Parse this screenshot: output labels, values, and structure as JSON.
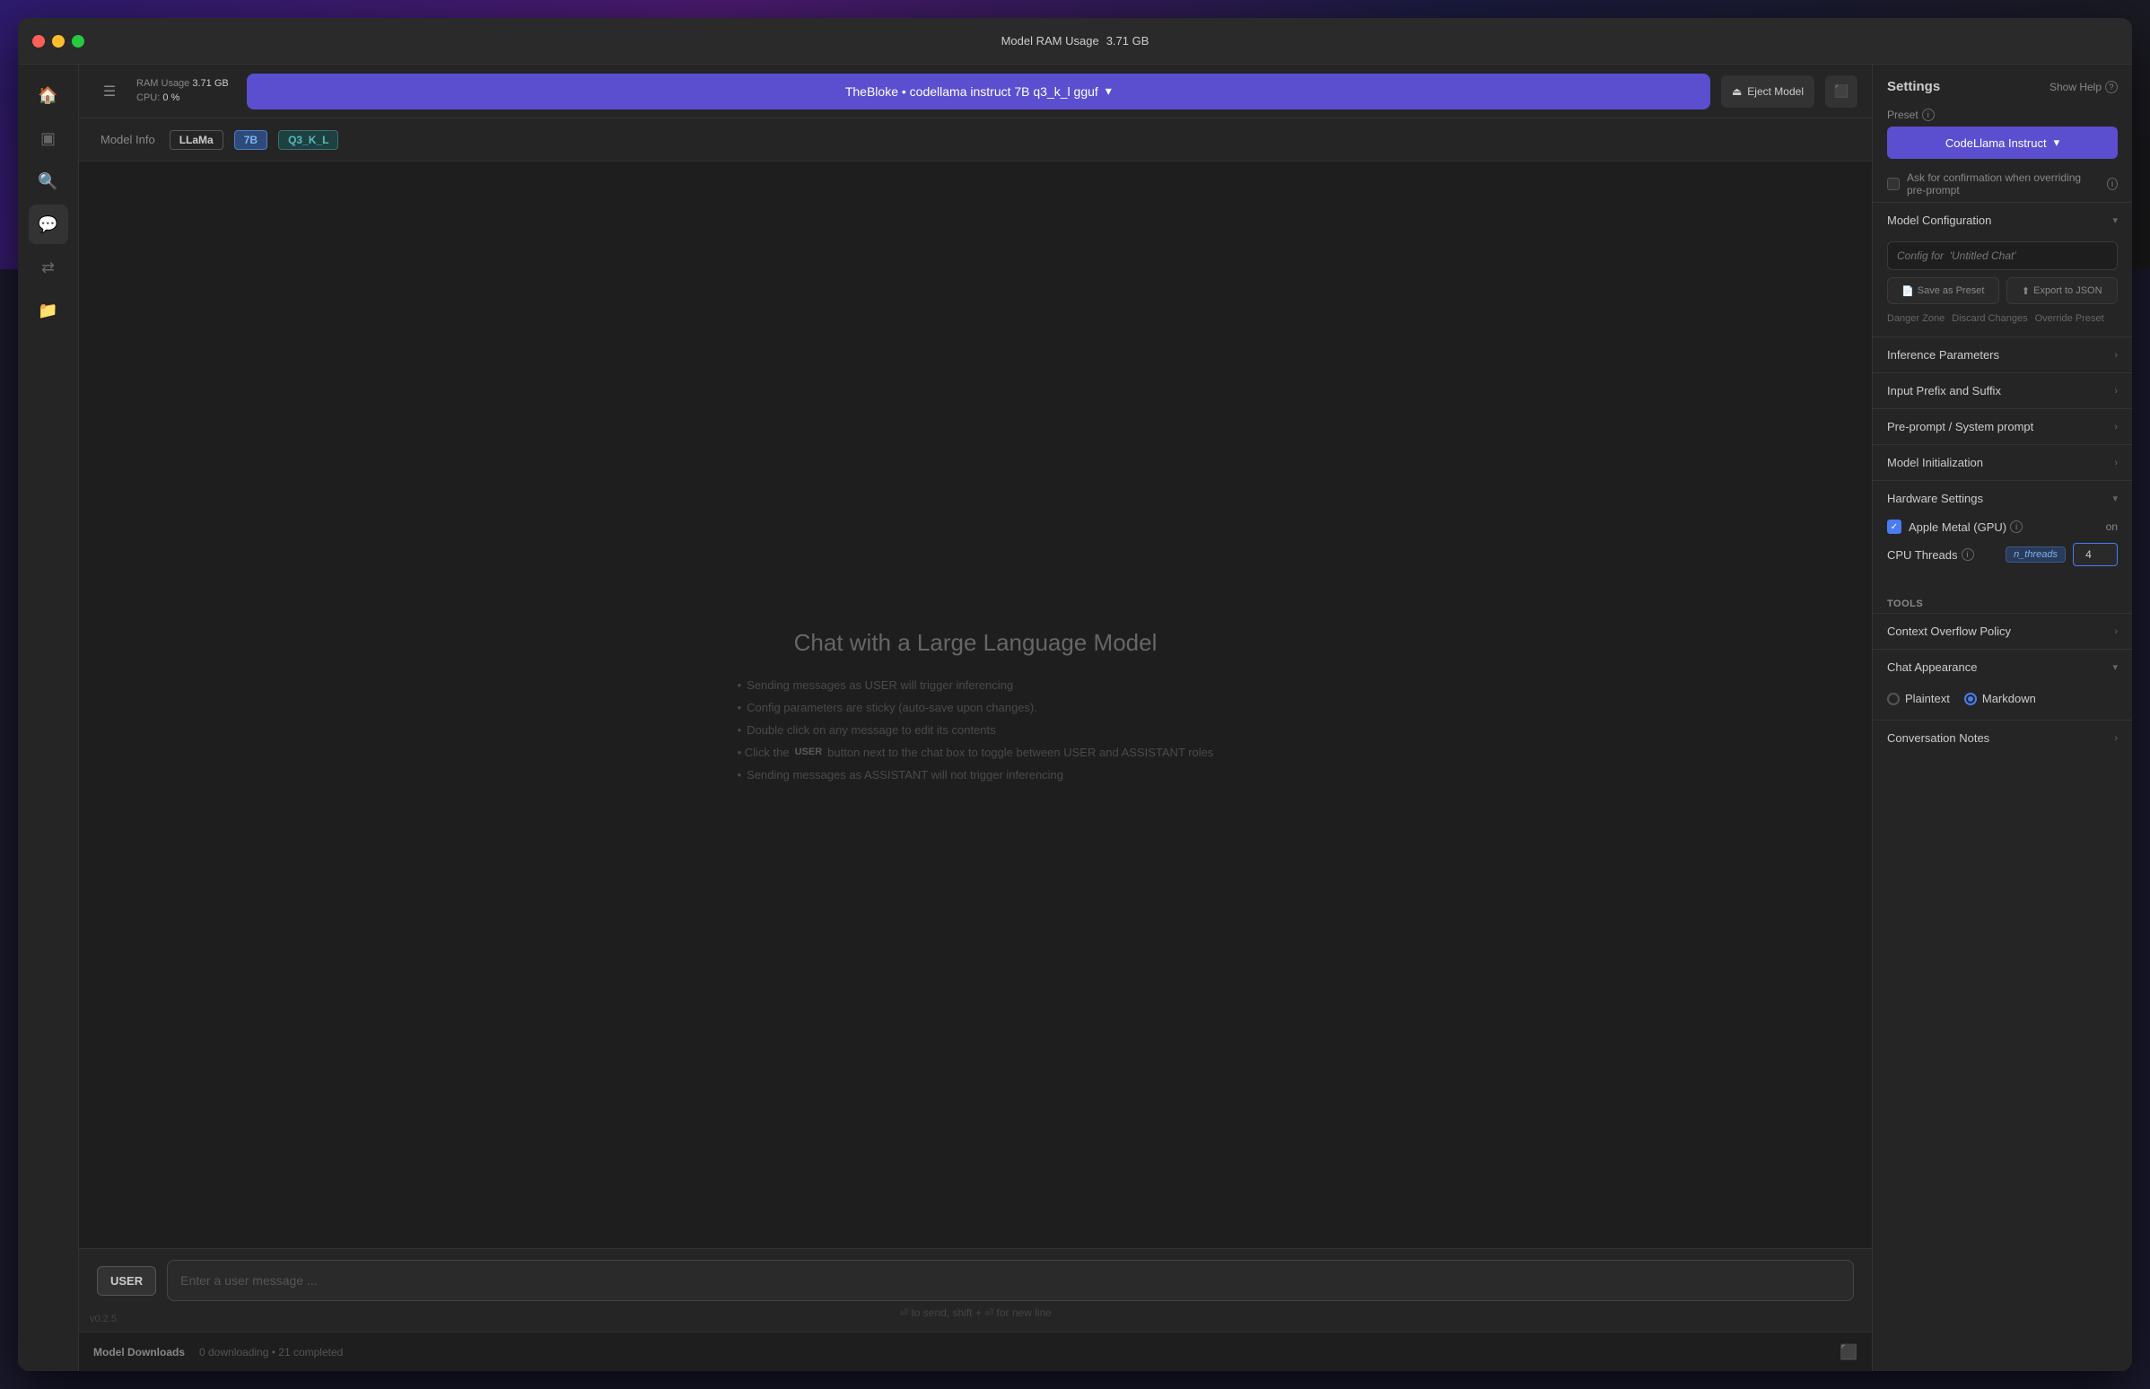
{
  "window": {
    "title_prefix": "Model RAM Usage",
    "title_value": "3.71 GB"
  },
  "topbar": {
    "ram_label": "RAM Usage",
    "ram_value": "3.71 GB",
    "cpu_label": "CPU:",
    "cpu_value": "0 %",
    "model_name": "TheBloke • codellama instruct 7B q3_k_l gguf",
    "eject_label": "Eject Model",
    "toggle_icon": "⬛"
  },
  "model_info": {
    "label": "Model Info",
    "tag1": "LLaMa",
    "tag2": "7B",
    "tag3": "Q3_K_L"
  },
  "chat": {
    "welcome": "Chat with a Large Language Model",
    "hints": [
      "Sending messages as USER will trigger inferencing",
      "Config parameters are sticky (auto-save upon changes).",
      "Double click on any message to edit its contents",
      "Click the USER button next to the chat box to toggle between USER and ASSISTANT roles",
      "Sending messages as ASSISTANT will not trigger inferencing"
    ],
    "hint_keyword": "USER",
    "hint_keyword2": "USER",
    "hint_keyword3": "ASSISTANT",
    "input_placeholder": "Enter a user message ...",
    "user_badge": "USER",
    "input_hint": "⏎ to send, shift + ⏎ for new line",
    "version": "v0.2.5"
  },
  "status_bar": {
    "label": "Model Downloads",
    "text": "0 downloading • 21 completed"
  },
  "settings": {
    "title": "Settings",
    "show_help": "Show Help",
    "preset_label": "Preset",
    "preset_value": "CodeLlama Instruct",
    "preset_dropdown": "▾",
    "confirm_checkbox": false,
    "confirm_label": "Ask for confirmation when overriding pre-prompt",
    "config_placeholder": "Config for  'Untitled Chat'",
    "save_preset_label": "Save as Preset",
    "export_json_label": "Export to JSON",
    "danger_zone": "Danger Zone",
    "discard_changes": "Discard Changes",
    "override_preset": "Override Preset",
    "sections": [
      {
        "id": "inference",
        "title": "Inference Parameters",
        "collapsed": true,
        "arrow": "›"
      },
      {
        "id": "prefix_suffix",
        "title": "Input Prefix and Suffix",
        "collapsed": true,
        "arrow": "›"
      },
      {
        "id": "preprompt",
        "title": "Pre-prompt / System prompt",
        "collapsed": true,
        "arrow": "›"
      },
      {
        "id": "model_init",
        "title": "Model Initialization",
        "collapsed": true,
        "arrow": "›"
      },
      {
        "id": "hardware",
        "title": "Hardware Settings",
        "collapsed": false,
        "arrow": "▾"
      }
    ],
    "hardware": {
      "gpu_label": "Apple Metal (GPU)",
      "gpu_checked": true,
      "gpu_value": "on",
      "cpu_threads_label": "CPU Threads",
      "cpu_threads_tag": "n_threads",
      "cpu_threads_value": "4"
    },
    "tools": {
      "title": "Tools",
      "context_overflow": "Context Overflow Policy",
      "context_arrow": "›",
      "chat_appearance": "Chat Appearance",
      "chat_arrow": "▾",
      "appearance_options": [
        {
          "id": "plaintext",
          "label": "Plaintext",
          "selected": false
        },
        {
          "id": "markdown",
          "label": "Markdown",
          "selected": true
        }
      ],
      "conv_notes": "Conversation Notes",
      "conv_arrow": "›"
    }
  }
}
